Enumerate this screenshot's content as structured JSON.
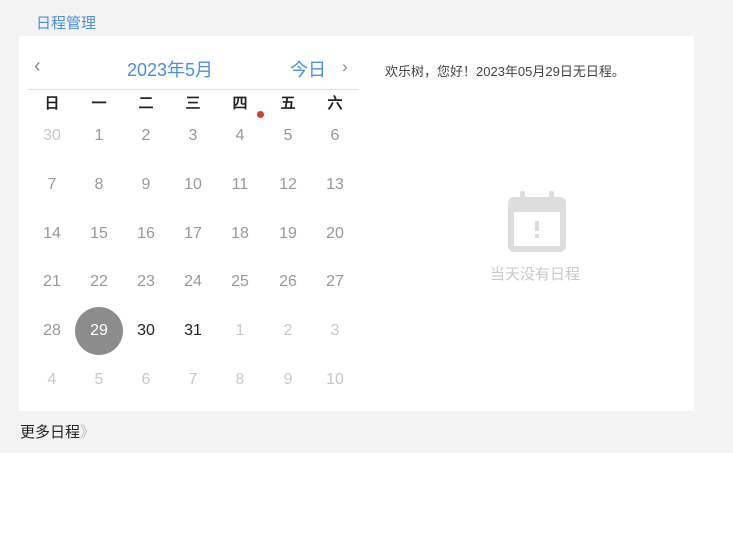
{
  "header": {
    "title": "日程管理"
  },
  "calendar": {
    "month_label": "2023年5月",
    "today_label": "今日",
    "weekdays": [
      "日",
      "一",
      "二",
      "三",
      "四",
      "五",
      "六"
    ],
    "weeks": [
      [
        [
          "30",
          "other"
        ],
        [
          "1",
          "past"
        ],
        [
          "2",
          "past"
        ],
        [
          "3",
          "past"
        ],
        [
          "4",
          "past"
        ],
        [
          "5",
          "past"
        ],
        [
          "6",
          "past"
        ]
      ],
      [
        [
          "7",
          "past"
        ],
        [
          "8",
          "past"
        ],
        [
          "9",
          "past"
        ],
        [
          "10",
          "past"
        ],
        [
          "11",
          "past"
        ],
        [
          "12",
          "past"
        ],
        [
          "13",
          "past"
        ]
      ],
      [
        [
          "14",
          "past"
        ],
        [
          "15",
          "past"
        ],
        [
          "16",
          "past"
        ],
        [
          "17",
          "past"
        ],
        [
          "18",
          "past"
        ],
        [
          "19",
          "past"
        ],
        [
          "20",
          "past"
        ]
      ],
      [
        [
          "21",
          "past"
        ],
        [
          "22",
          "past"
        ],
        [
          "23",
          "past"
        ],
        [
          "24",
          "past"
        ],
        [
          "25",
          "past"
        ],
        [
          "26",
          "past"
        ],
        [
          "27",
          "past"
        ]
      ],
      [
        [
          "28",
          "past"
        ],
        [
          "29",
          "sel"
        ],
        [
          "30",
          "cur"
        ],
        [
          "31",
          "cur"
        ],
        [
          "1",
          "other"
        ],
        [
          "2",
          "other"
        ],
        [
          "3",
          "other"
        ]
      ],
      [
        [
          "4",
          "other"
        ],
        [
          "5",
          "other"
        ],
        [
          "6",
          "other"
        ],
        [
          "7",
          "other"
        ],
        [
          "8",
          "other"
        ],
        [
          "9",
          "other"
        ],
        [
          "10",
          "other"
        ]
      ]
    ],
    "accent": "#4a8ee6",
    "marker_color": "#d9393b"
  },
  "schedule": {
    "greeting": "欢乐树，您好！2023年05月29日无日程。",
    "empty_text": "当天没有日程",
    "empty_icon": "calendar-alert-icon"
  },
  "footer": {
    "more_label": "更多日程",
    "more_arrow": "》"
  }
}
